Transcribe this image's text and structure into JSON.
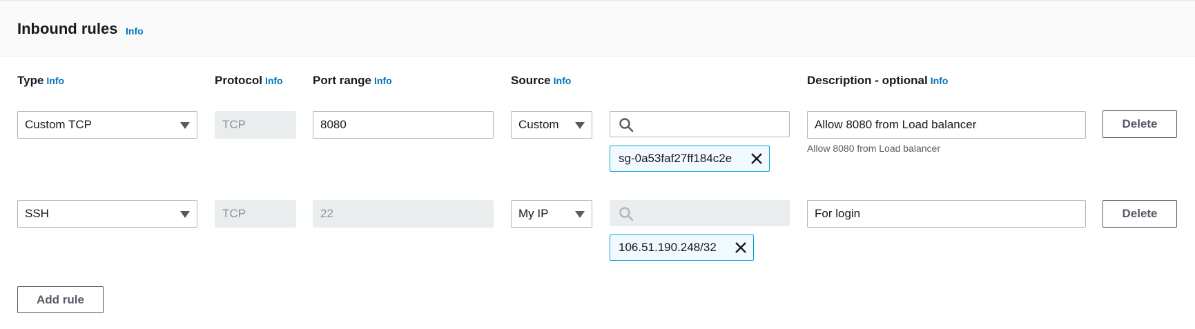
{
  "header": {
    "title": "Inbound rules",
    "info": "Info"
  },
  "columns": {
    "type": "Type",
    "protocol": "Protocol",
    "port_range": "Port range",
    "source": "Source",
    "description": "Description - optional",
    "info": "Info"
  },
  "rules": [
    {
      "type": "Custom TCP",
      "protocol": "TCP",
      "port_range": "8080",
      "source_type": "Custom",
      "source_token": "sg-0a53faf27ff184c2e",
      "description": "Allow 8080 from Load balancer",
      "description_hint": "Allow 8080 from Load balancer",
      "delete_label": "Delete"
    },
    {
      "type": "SSH",
      "protocol": "TCP",
      "port_range": "22",
      "source_type": "My IP",
      "source_token": "106.51.190.248/32",
      "description": "For login",
      "delete_label": "Delete"
    }
  ],
  "add_rule_label": "Add rule",
  "icons": {
    "search": "search-icon",
    "remove": "close-icon",
    "dropdown": "caret-down-icon"
  },
  "colors": {
    "link": "#0073bb",
    "token_border": "#00a1c9",
    "disabled_bg": "#eaeded"
  }
}
